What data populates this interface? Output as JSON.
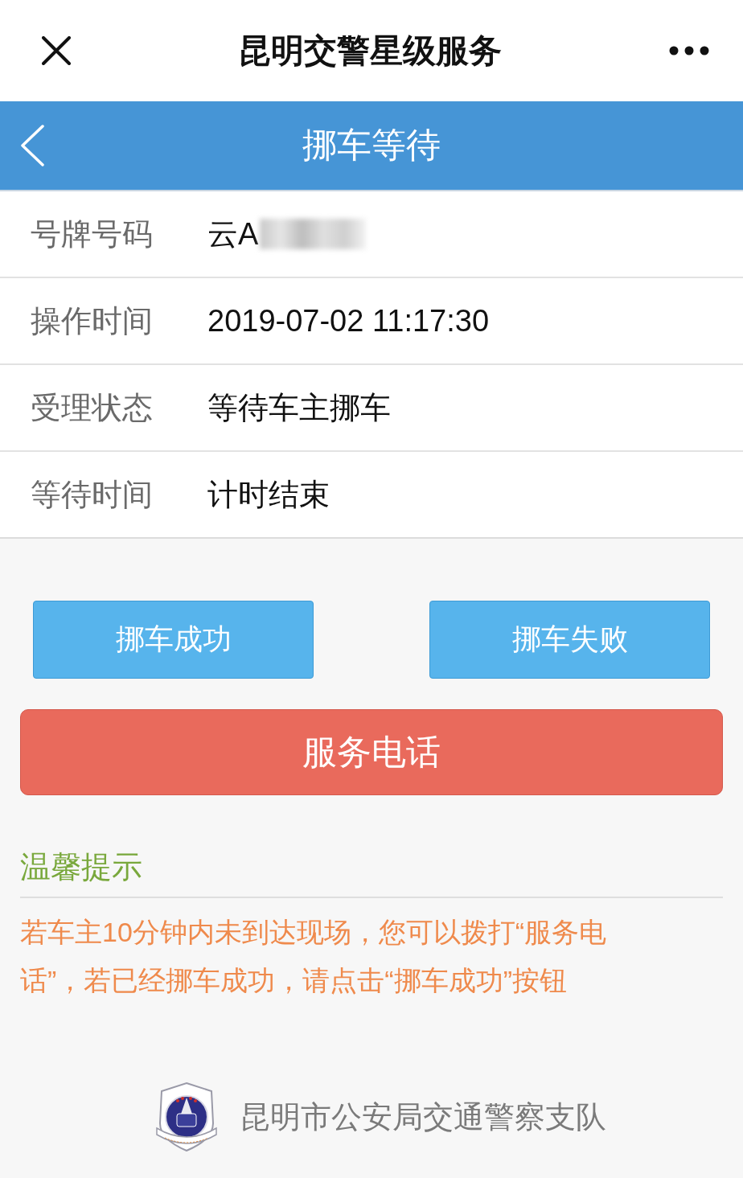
{
  "top_bar": {
    "title": "昆明交警星级服务"
  },
  "header": {
    "title": "挪车等待"
  },
  "fields": [
    {
      "label": "号牌号码",
      "value": "云A",
      "redacted": true
    },
    {
      "label": "操作时间",
      "value": "2019-07-02 11:17:30",
      "redacted": false
    },
    {
      "label": "受理状态",
      "value": "等待车主挪车",
      "redacted": false
    },
    {
      "label": "等待时间",
      "value": "计时结束",
      "redacted": false
    }
  ],
  "buttons": [
    {
      "label": "挪车成功",
      "kind": "primary"
    },
    {
      "label": "挪车失败",
      "kind": "primary"
    },
    {
      "label": "服务电话",
      "kind": "danger"
    }
  ],
  "notice": {
    "title": "温馨提示",
    "text": "若车主10分钟内未到达现场，您可以拨打“服务电话”，若已经挪车成功，请点击“挪车成功”按钮"
  },
  "footer": {
    "text": "昆明市公安局交通警察支队"
  }
}
